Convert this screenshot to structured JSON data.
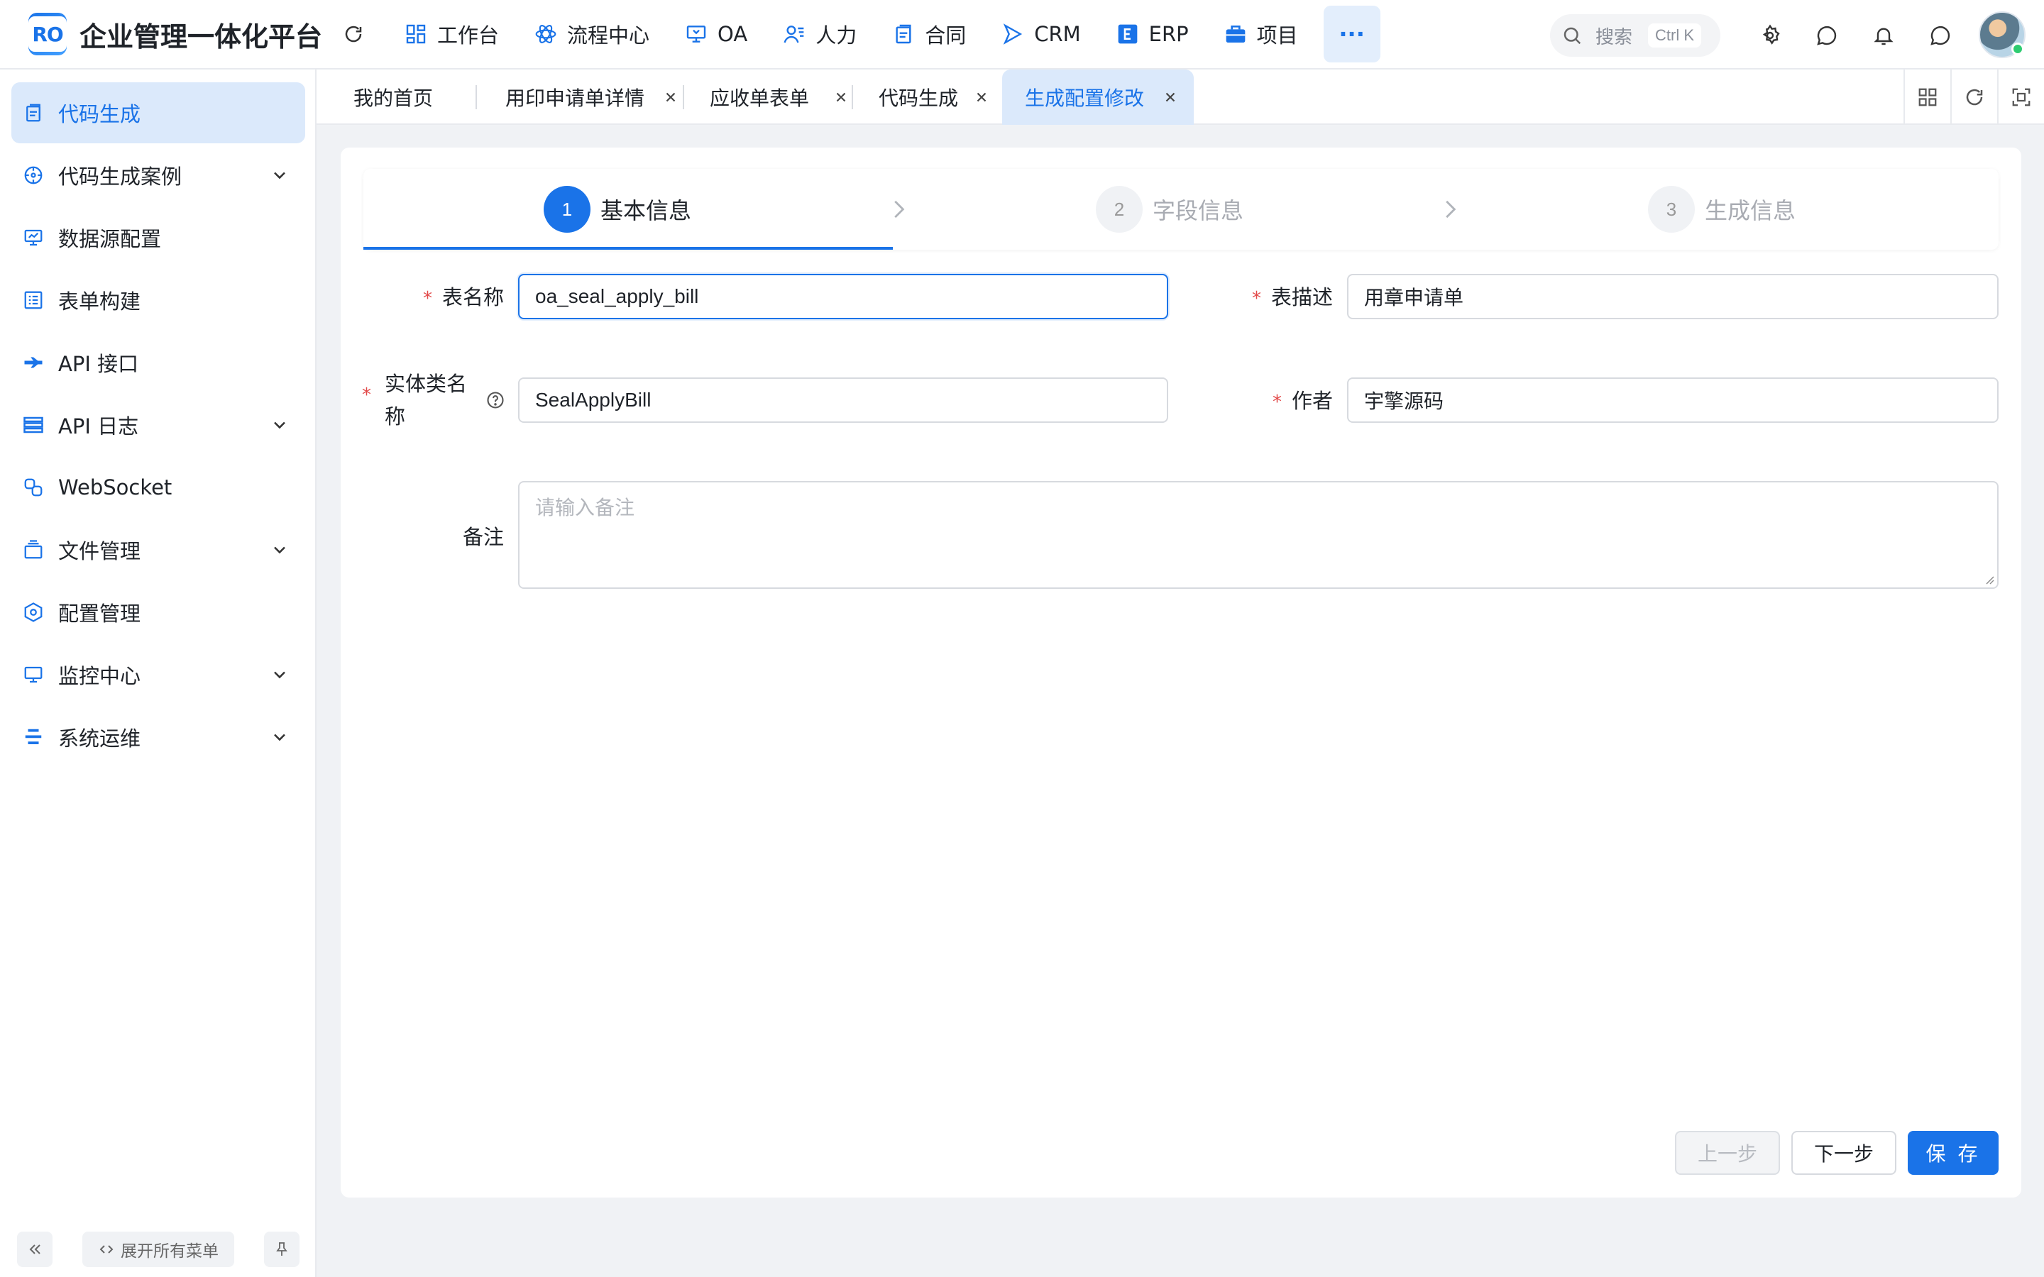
{
  "app": {
    "logo_text": "RO",
    "title": "企业管理一体化平台"
  },
  "topnav": [
    {
      "label": "工作台",
      "icon": "dashboard-icon"
    },
    {
      "label": "流程中心",
      "icon": "workflow-icon"
    },
    {
      "label": "OA",
      "icon": "oa-monitor-icon"
    },
    {
      "label": "人力",
      "icon": "people-icon"
    },
    {
      "label": "合同",
      "icon": "contract-icon"
    },
    {
      "label": "CRM",
      "icon": "crm-icon"
    },
    {
      "label": "ERP",
      "icon": "erp-icon"
    },
    {
      "label": "项目",
      "icon": "briefcase-icon"
    }
  ],
  "more_label": "···",
  "search": {
    "placeholder": "搜索",
    "shortcut": "Ctrl K"
  },
  "sidebar": {
    "items": [
      {
        "label": "代码生成",
        "icon": "code-doc-icon",
        "active": true,
        "expandable": false
      },
      {
        "label": "代码生成案例",
        "icon": "compass-icon",
        "active": false,
        "expandable": true
      },
      {
        "label": "数据源配置",
        "icon": "datasource-icon",
        "active": false,
        "expandable": false
      },
      {
        "label": "表单构建",
        "icon": "form-icon",
        "active": false,
        "expandable": false
      },
      {
        "label": "API 接口",
        "icon": "api-icon",
        "active": false,
        "expandable": false
      },
      {
        "label": "API 日志",
        "icon": "log-icon",
        "active": false,
        "expandable": true
      },
      {
        "label": "WebSocket",
        "icon": "websocket-icon",
        "active": false,
        "expandable": false
      },
      {
        "label": "文件管理",
        "icon": "file-icon",
        "active": false,
        "expandable": true
      },
      {
        "label": "配置管理",
        "icon": "config-icon",
        "active": false,
        "expandable": false
      },
      {
        "label": "监控中心",
        "icon": "monitor-icon",
        "active": false,
        "expandable": true
      },
      {
        "label": "系统运维",
        "icon": "ops-icon",
        "active": false,
        "expandable": true
      }
    ],
    "expand_all_label": "展开所有菜单"
  },
  "tabs": [
    {
      "label": "我的首页",
      "closable": false,
      "active": false
    },
    {
      "label": "用印申请单详情",
      "closable": true,
      "active": false
    },
    {
      "label": "应收单表单",
      "closable": true,
      "active": false
    },
    {
      "label": "代码生成",
      "closable": true,
      "active": false
    },
    {
      "label": "生成配置修改",
      "closable": true,
      "active": true
    }
  ],
  "steps": [
    {
      "num": "1",
      "label": "基本信息",
      "active": true
    },
    {
      "num": "2",
      "label": "字段信息",
      "active": false
    },
    {
      "num": "3",
      "label": "生成信息",
      "active": false
    }
  ],
  "form": {
    "table_name": {
      "label": "表名称",
      "value": "oa_seal_apply_bill",
      "required": true
    },
    "table_desc": {
      "label": "表描述",
      "value": "用章申请单",
      "required": true
    },
    "entity_name": {
      "label_line1": "实体类名",
      "label_line2": "称",
      "value": "SealApplyBill",
      "required": true
    },
    "author": {
      "label": "作者",
      "value": "宇擎源码",
      "required": true
    },
    "remark": {
      "label": "备注",
      "value": "",
      "placeholder": "请输入备注"
    }
  },
  "buttons": {
    "prev": "上一步",
    "next": "下一步",
    "save": "保 存"
  },
  "colors": {
    "accent": "#1a73e8",
    "active_bg": "#dbe9fb",
    "required": "#e24a4a"
  }
}
